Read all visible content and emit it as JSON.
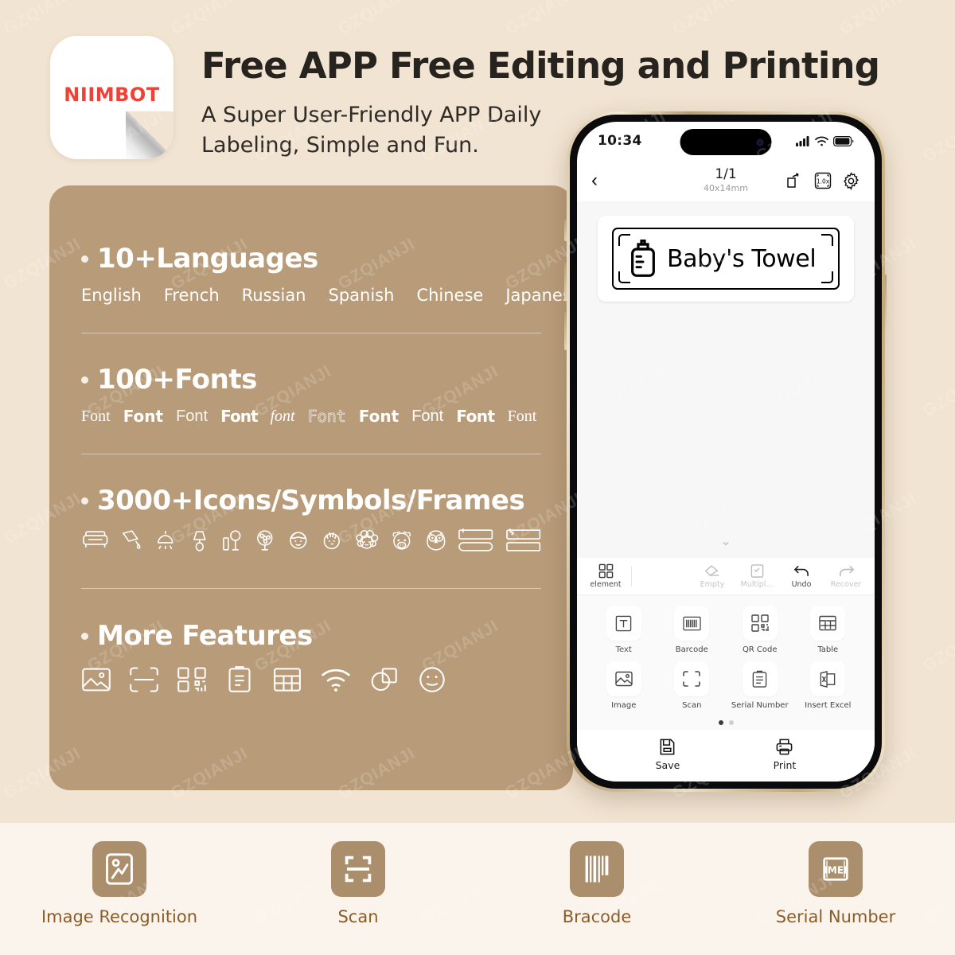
{
  "brand": {
    "logo_text": "NIIMBOT",
    "logo_color": "#ef4136"
  },
  "header": {
    "title": "Free APP Free Editing and Printing",
    "subtitle": "A Super User-Friendly APP Daily Labeling, Simple and Fun."
  },
  "theme": {
    "page_bg": "#f2e4d2",
    "card_bg": "#b89b79",
    "bottom_bg": "#fbf4ec",
    "bottom_tile": "#ab8f6d",
    "bottom_label": "#8a5c28"
  },
  "watermark": {
    "text": "GZQIANJI"
  },
  "features": [
    {
      "heading": "10+Languages",
      "kind": "languages",
      "languages": [
        "English",
        "French",
        "Russian",
        "Spanish",
        "Chinese",
        "Japanese"
      ]
    },
    {
      "heading": "100+Fonts",
      "kind": "fonts",
      "samples": [
        "Font",
        "Font",
        "Font",
        "Font",
        "font",
        "Font",
        "Font",
        "Font",
        "Font",
        "Font"
      ]
    },
    {
      "heading": "3000+Icons/Symbols/Frames",
      "kind": "icons",
      "icons": [
        "sofa-icon",
        "paint-roller-icon",
        "pendant-lamp-icon",
        "table-lamp-icon",
        "floor-lamp-icon",
        "fan-icon",
        "boy-face-icon",
        "child-face-icon",
        "curly-hair-face-icon",
        "cow-face-icon",
        "owl-icon",
        "frame-stacked-icon",
        "frame-arrow-icon"
      ]
    },
    {
      "heading": "More Features",
      "kind": "more",
      "icons": [
        "image-icon",
        "scan-icon",
        "qr-code-icon",
        "clipboard-icon",
        "table-icon",
        "wifi-icon",
        "shapes-icon",
        "smiley-icon"
      ]
    }
  ],
  "phone": {
    "status": {
      "time": "10:34",
      "signal": "cellular-icon",
      "wifi": "wifi-icon",
      "battery": "battery-icon"
    },
    "nav": {
      "back": "back-chevron-icon",
      "page": "1/1",
      "size": "40x14mm",
      "actions": [
        "share-icon",
        "zoom-1-0x-icon",
        "settings-gear-icon"
      ]
    },
    "label": {
      "icon": "baby-bottle-icon",
      "text": "Baby's Towel"
    },
    "collapse": "chevron-double-down-icon",
    "toolbar": {
      "element": {
        "label": "element",
        "icon": "grid-icon"
      },
      "right": [
        {
          "label": "Empty",
          "icon": "eraser-icon",
          "enabled": false
        },
        {
          "label": "Multipl...",
          "icon": "multiply-icon",
          "enabled": false
        },
        {
          "label": "Undo",
          "icon": "undo-icon",
          "enabled": true
        },
        {
          "label": "Recover",
          "icon": "redo-icon",
          "enabled": false
        }
      ]
    },
    "tools": [
      {
        "label": "Text",
        "icon": "text-icon"
      },
      {
        "label": "Barcode",
        "icon": "barcode-icon"
      },
      {
        "label": "QR Code",
        "icon": "qr-code-icon"
      },
      {
        "label": "Table",
        "icon": "table-icon"
      },
      {
        "label": "Image",
        "icon": "image-icon"
      },
      {
        "label": "Scan",
        "icon": "scan-icon"
      },
      {
        "label": "Serial Number",
        "icon": "serial-number-icon"
      },
      {
        "label": "Insert Excel",
        "icon": "insert-excel-icon"
      }
    ],
    "pager": {
      "pages": 2,
      "active": 0
    },
    "actions": [
      {
        "label": "Save",
        "icon": "save-icon"
      },
      {
        "label": "Print",
        "icon": "print-icon"
      }
    ]
  },
  "bottom_features": [
    {
      "label": "Image Recognition",
      "icon": "image-recognition-icon"
    },
    {
      "label": "Scan",
      "icon": "scan-icon"
    },
    {
      "label": "Bracode",
      "icon": "barcode-icon"
    },
    {
      "label": "Serial Number",
      "icon": "imei-icon"
    }
  ]
}
